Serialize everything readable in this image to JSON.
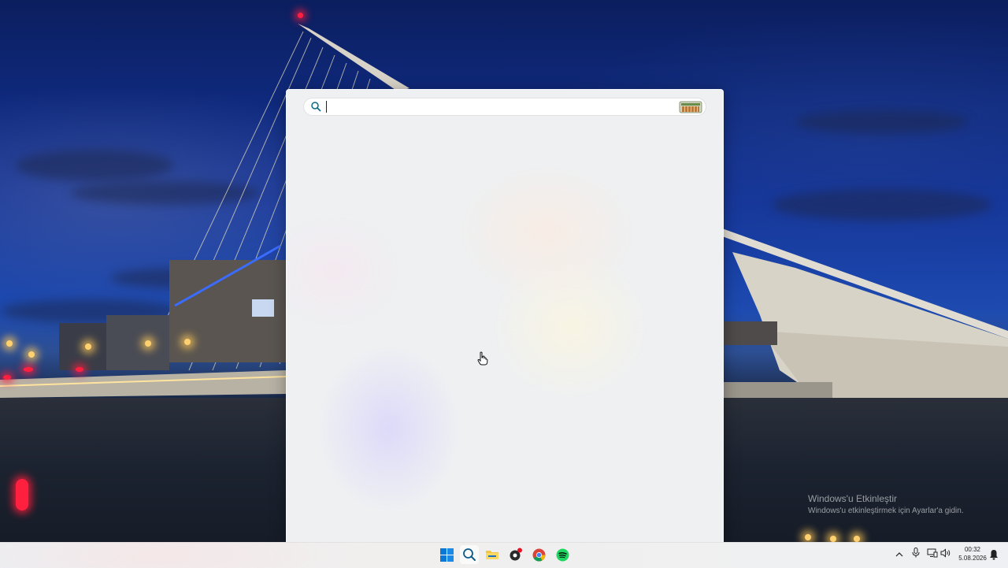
{
  "search": {
    "placeholder": "",
    "value": ""
  },
  "watermark": {
    "title": "Windows'u Etkinleştir",
    "subtitle": "Windows'u etkinleştirmek için Ayarlar'a gidin."
  },
  "taskbar": {
    "apps": [
      {
        "name": "start",
        "icon": "windows-logo-icon"
      },
      {
        "name": "search",
        "icon": "search-icon",
        "active": true
      },
      {
        "name": "file-explorer",
        "icon": "folder-icon"
      },
      {
        "name": "app-with-badge",
        "icon": "badge-app-icon"
      },
      {
        "name": "chrome",
        "icon": "chrome-icon"
      },
      {
        "name": "spotify",
        "icon": "spotify-icon"
      }
    ],
    "tray": {
      "chevron_icon": "chevron-up-icon",
      "mic_icon": "microphone-icon",
      "display_icon": "display-icon",
      "volume_icon": "volume-icon"
    },
    "clock": {
      "time": "00:32",
      "date": "5.08.2026"
    }
  },
  "colors": {
    "accent": "#0067c0",
    "spotify": "#1ed760",
    "folder": "#f4c542"
  }
}
